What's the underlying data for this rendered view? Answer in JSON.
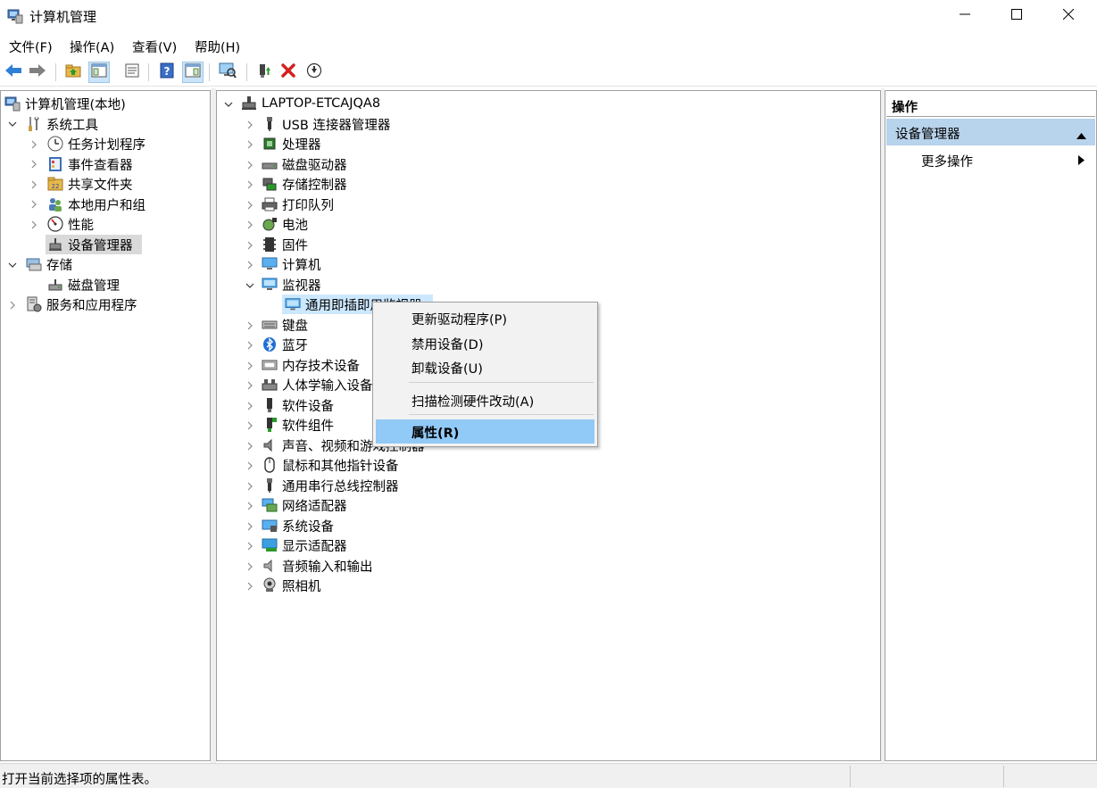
{
  "window": {
    "title": "计算机管理",
    "controls": [
      "minimize-icon",
      "maximize-icon",
      "close-icon"
    ]
  },
  "menubar": [
    "文件(F)",
    "操作(A)",
    "查看(V)",
    "帮助(H)"
  ],
  "toolbar": [
    "back-arrow-icon",
    "forward-arrow-icon",
    "folder-up-icon",
    "show-tree-icon",
    "properties-sheet-icon",
    "help-icon",
    "action-pane-icon",
    "scan-monitor-icon",
    "update-driver-icon",
    "uninstall-x-icon",
    "download-circle-icon"
  ],
  "left_tree": {
    "root": "计算机管理(本地)",
    "system_tools": "系统工具",
    "task_scheduler": "任务计划程序",
    "event_viewer": "事件查看器",
    "shared_folders": "共享文件夹",
    "local_users": "本地用户和组",
    "performance": "性能",
    "device_manager": "设备管理器",
    "storage": "存储",
    "disk_management": "磁盘管理",
    "services_apps": "服务和应用程序"
  },
  "device_tree": {
    "root": "LAPTOP-ETCAJQA8",
    "categories": [
      "USB 连接器管理器",
      "处理器",
      "磁盘驱动器",
      "存储控制器",
      "打印队列",
      "电池",
      "固件",
      "计算机",
      "监视器",
      "键盘",
      "蓝牙",
      "内存技术设备",
      "人体学输入设备",
      "软件设备",
      "软件组件",
      "声音、视频和游戏控制器",
      "鼠标和其他指针设备",
      "通用串行总线控制器",
      "网络适配器",
      "系统设备",
      "显示适配器",
      "音频输入和输出",
      "照相机"
    ],
    "monitor_child": "通用即插即用监视器"
  },
  "context_menu": {
    "update_driver": "更新驱动程序(P)",
    "disable_device": "禁用设备(D)",
    "uninstall_device": "卸载设备(U)",
    "scan_hardware": "扫描检测硬件改动(A)",
    "properties": "属性(R)"
  },
  "actions_pane": {
    "header": "操作",
    "group": "设备管理器",
    "more": "更多操作"
  },
  "status": {
    "text": "打开当前选择项的属性表。"
  },
  "colors": {
    "selection_gray": "#d9d9d9",
    "selection_blue": "#cce8ff",
    "context_highlight": "#91c9f7",
    "actions_group_bg": "#b8d3ec"
  }
}
